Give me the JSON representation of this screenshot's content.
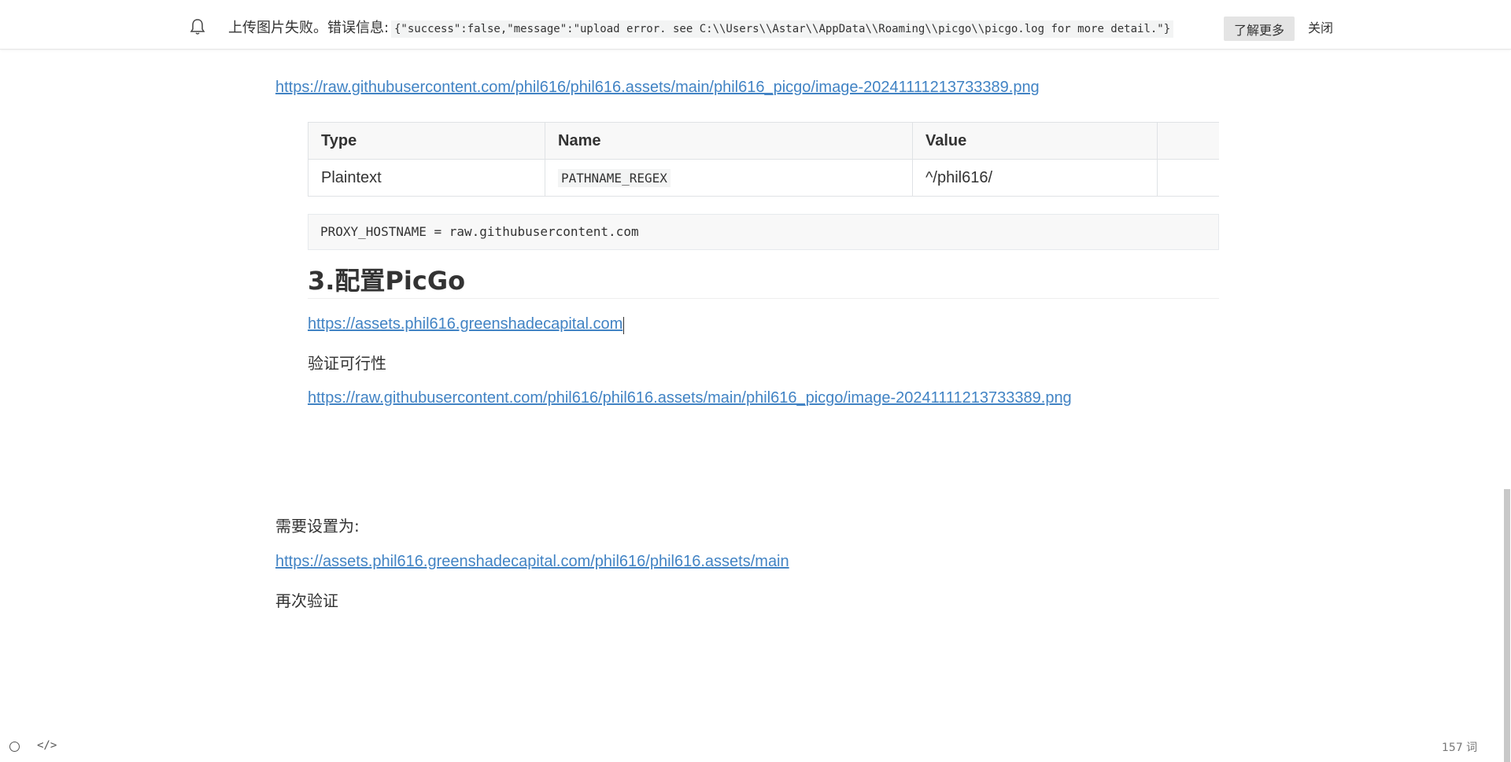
{
  "notification": {
    "message": "上传图片失败。错误信息:",
    "error_detail": "{\"success\":false,\"message\":\"upload error. see C:\\\\Users\\\\Astar\\\\AppData\\\\Roaming\\\\picgo\\\\picgo.log for more detail.\"}",
    "learn_more_label": "了解更多",
    "close_label": "关闭",
    "icon": "bell-icon"
  },
  "document": {
    "top_link": "https://raw.githubusercontent.com/phil616/phil616.assets/main/phil616_picgo/image-20241111213733389.png",
    "table": {
      "headers": [
        "Type",
        "Name",
        "Value",
        ""
      ],
      "rows": [
        [
          "Plaintext",
          "PATHNAME_REGEX",
          "^/phil616/",
          ""
        ]
      ]
    },
    "code_block": "PROXY_HOSTNAME = raw.githubusercontent.com",
    "heading": "3.配置PicGo",
    "config_link": "https://assets.phil616.greenshadecapital.com",
    "verify_text": "验证可行性",
    "verify_link": "https://raw.githubusercontent.com/phil616/phil616.assets/main/phil616_picgo/image-20241111213733389.png",
    "need_set_text": "需要设置为:",
    "set_link": "https://assets.phil616.greenshadecapital.com/phil616/phil616.assets/main",
    "reverify_text": "再次验证"
  },
  "footer": {
    "source_toggle_icon": "code-icon",
    "status_icon": "circle-icon",
    "source_toggle_label": "</>",
    "word_count": "157 词"
  },
  "colors": {
    "link": "#4183c4",
    "text": "#333333",
    "button_bg": "#e4e4e4",
    "scrollbar_thumb": "#c8c8c8"
  }
}
